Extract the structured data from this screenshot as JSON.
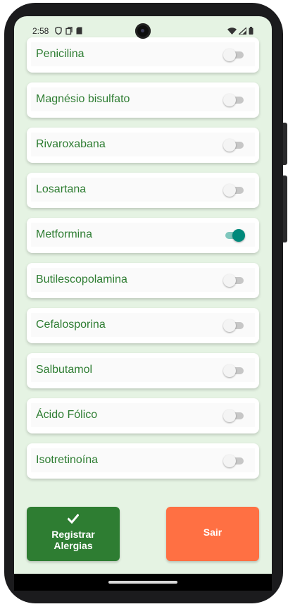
{
  "status_bar": {
    "time": "2:58",
    "left_icons": [
      "shield-icon",
      "screenshot-icon",
      "sd-card-icon"
    ],
    "right_icons": [
      "wifi-icon",
      "signal-icon",
      "battery-icon"
    ]
  },
  "allergy_list": {
    "items": [
      {
        "label": "Penicilina",
        "enabled": false
      },
      {
        "label": "Magnésio bisulfato",
        "enabled": false
      },
      {
        "label": "Rivaroxabana",
        "enabled": false
      },
      {
        "label": "Losartana",
        "enabled": false
      },
      {
        "label": "Metformina",
        "enabled": true
      },
      {
        "label": "Butilescopolamina",
        "enabled": false
      },
      {
        "label": "Cefalosporina",
        "enabled": false
      },
      {
        "label": "Salbutamol",
        "enabled": false
      },
      {
        "label": "Ácido Fólico",
        "enabled": false
      },
      {
        "label": "Isotretinoína",
        "enabled": false
      }
    ]
  },
  "actions": {
    "register_label": "Registrar\nAlergias",
    "register_icon": "check-icon",
    "exit_label": "Sair"
  },
  "colors": {
    "background": "#e5f3e3",
    "label_text": "#2e7d32",
    "register_button": "#2e7d32",
    "exit_button": "#ff7043",
    "switch_on": "#00897b"
  }
}
